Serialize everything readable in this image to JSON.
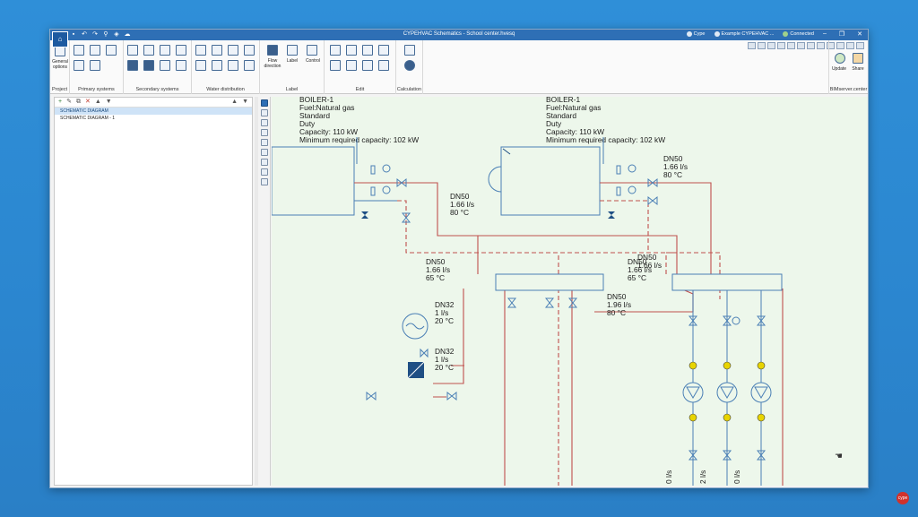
{
  "window": {
    "title": "CYPEHVAC Schematics - School center.hvesq",
    "top_right_items": [
      "Cype",
      "Example CYPEHVAC ...",
      "Connected"
    ]
  },
  "ribbon": {
    "groups": [
      {
        "label": "Project",
        "buttons": [
          "General options"
        ]
      },
      {
        "label": "Primary systems",
        "buttons": []
      },
      {
        "label": "Secondary systems",
        "buttons": []
      },
      {
        "label": "Water distribution",
        "buttons": []
      },
      {
        "label": "Label",
        "buttons": [
          "Flow direction",
          "Label",
          "Control"
        ]
      },
      {
        "label": "Edit",
        "buttons": []
      },
      {
        "label": "Calculation",
        "buttons": []
      },
      {
        "label": "BIMserver.center",
        "buttons": [
          "Update",
          "Share"
        ]
      }
    ]
  },
  "tree": {
    "items": [
      "SCHEMATIC DIAGRAM",
      "SCHEMATIC DIAGRAM - 1"
    ],
    "selected_index": 0
  },
  "diagram": {
    "boilers": [
      {
        "name": "BOILER-1",
        "fuel": "Fuel:Natural gas",
        "type": "Standard",
        "mode": "Duty",
        "capacity": "Capacity: 110 kW",
        "min_capacity": "Minimum required capacity: 102 kW"
      },
      {
        "name": "BOILER-1",
        "fuel": "Fuel:Natural gas",
        "type": "Standard",
        "mode": "Duty",
        "capacity": "Capacity: 110 kW",
        "min_capacity": "Minimum required capacity: 102 kW"
      }
    ],
    "pipe_labels": [
      {
        "dn": "DN50",
        "flow": "1.66 l/s",
        "temp": "80 °C"
      },
      {
        "dn": "DN50",
        "flow": "1.66 l/s",
        "temp": "80 °C"
      },
      {
        "dn": "DN50",
        "flow": "1.66 l/s",
        "temp": "65 °C"
      },
      {
        "dn": "DN50",
        "flow": "1.66 l/s",
        "temp": "65 °C"
      },
      {
        "dn": "DN50",
        "flow": "1.66 l/s",
        "temp": ""
      },
      {
        "dn": "DN32",
        "flow": "1 l/s",
        "temp": "20 °C"
      },
      {
        "dn": "DN50",
        "flow": "1.96 l/s",
        "temp": "80 °C"
      },
      {
        "dn": "DN32",
        "flow": "1 l/s",
        "temp": "20 °C"
      }
    ],
    "bottom_labels": [
      "0 l/s",
      "2 l/s",
      "0 l/s"
    ]
  },
  "colors": {
    "canvas_bg": "#edf7eb",
    "supply_pipe": "#c0504d",
    "return_pipe": "#c0504d",
    "equipment": "#4a7fb5",
    "sensor": "#e8d400"
  }
}
